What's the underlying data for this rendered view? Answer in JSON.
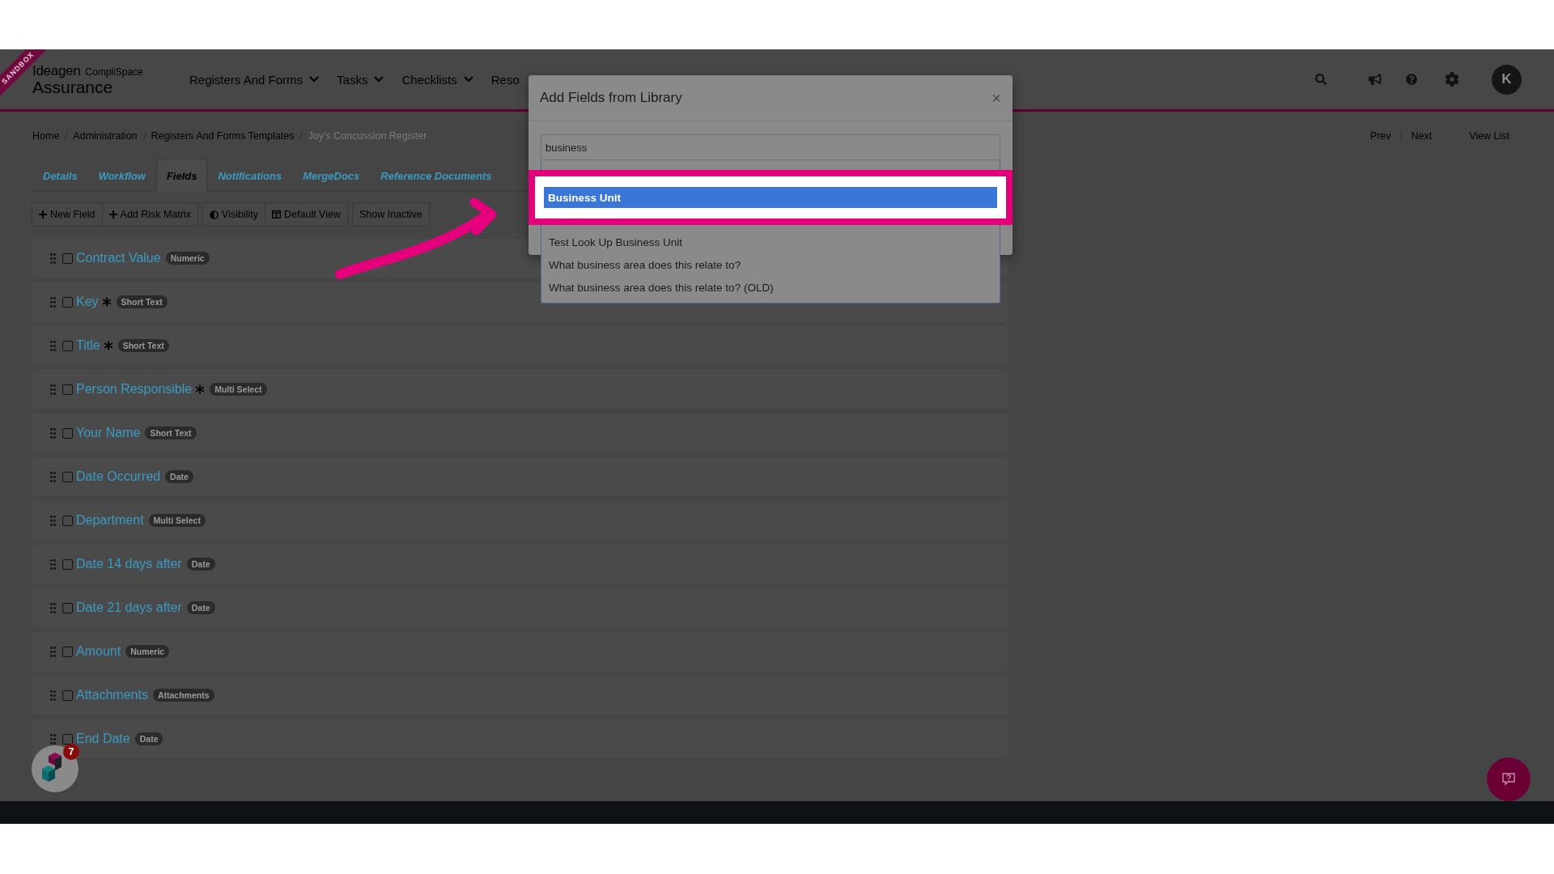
{
  "sandbox_ribbon": "SANDBOX",
  "logo": {
    "brand": "Ideagen",
    "product": "CompliSpace",
    "subtitle": "Assurance"
  },
  "nav": [
    {
      "label": "Registers And Forms",
      "chevron": true
    },
    {
      "label": "Tasks",
      "chevron": true
    },
    {
      "label": "Checklists",
      "chevron": true
    },
    {
      "label": "Reso",
      "chevron": false
    }
  ],
  "avatar": "K",
  "breadcrumb": [
    "Home",
    "Administration",
    "Registers And Forms Templates",
    "Joy's Concussion Register"
  ],
  "pager": {
    "prev": "Prev",
    "next": "Next",
    "view_list": "View List"
  },
  "tabs": [
    {
      "label": "Details",
      "selected": false
    },
    {
      "label": "Workflow",
      "selected": false
    },
    {
      "label": "Fields",
      "selected": true
    },
    {
      "label": "Notifications",
      "selected": false
    },
    {
      "label": "MergeDocs",
      "selected": false
    },
    {
      "label": "Reference Documents",
      "selected": false
    }
  ],
  "toolbar": [
    [
      {
        "kind": "add",
        "label": "New Field"
      },
      {
        "kind": "add",
        "label": "Add Risk Matrix"
      }
    ],
    [
      {
        "kind": "visibility",
        "label": "Visibility"
      },
      {
        "kind": "view",
        "label": "Default View"
      }
    ],
    [
      {
        "kind": "plain",
        "label": "Show Inactive"
      }
    ]
  ],
  "fields": [
    {
      "label": "Contract Value",
      "required": false,
      "type": "Numeric",
      "checked": false
    },
    {
      "label": "Key",
      "required": true,
      "type": "Short Text",
      "checked": false
    },
    {
      "label": "Title",
      "required": true,
      "type": "Short Text",
      "checked": false
    },
    {
      "label": "Person Responsible",
      "required": true,
      "type": "Multi Select",
      "checked": false
    },
    {
      "label": "Your Name",
      "required": false,
      "type": "Short Text",
      "checked": false
    },
    {
      "label": "Date Occurred",
      "required": false,
      "type": "Date",
      "checked": false
    },
    {
      "label": "Department",
      "required": false,
      "type": "Multi Select",
      "checked": false
    },
    {
      "label": "Date 14 days after",
      "required": false,
      "type": "Date",
      "checked": false
    },
    {
      "label": "Date 21 days after",
      "required": false,
      "type": "Date",
      "checked": false
    },
    {
      "label": "Amount",
      "required": false,
      "type": "Numeric",
      "checked": false
    },
    {
      "label": "Attachments",
      "required": false,
      "type": "Attachments",
      "checked": false
    },
    {
      "label": "End Date",
      "required": false,
      "type": "Date",
      "checked": false
    }
  ],
  "modal": {
    "title": "Add Fields from Library",
    "close": "×",
    "search_value": "business",
    "options": [
      {
        "label": "Business Unit",
        "selected": true
      },
      {
        "label": "Test Look Up Business Unit",
        "selected": false
      },
      {
        "label": "What business area does this relate to?",
        "selected": false
      },
      {
        "label": "What business area does this relate to? (OLD)",
        "selected": false
      }
    ]
  },
  "notification_badge": "7"
}
